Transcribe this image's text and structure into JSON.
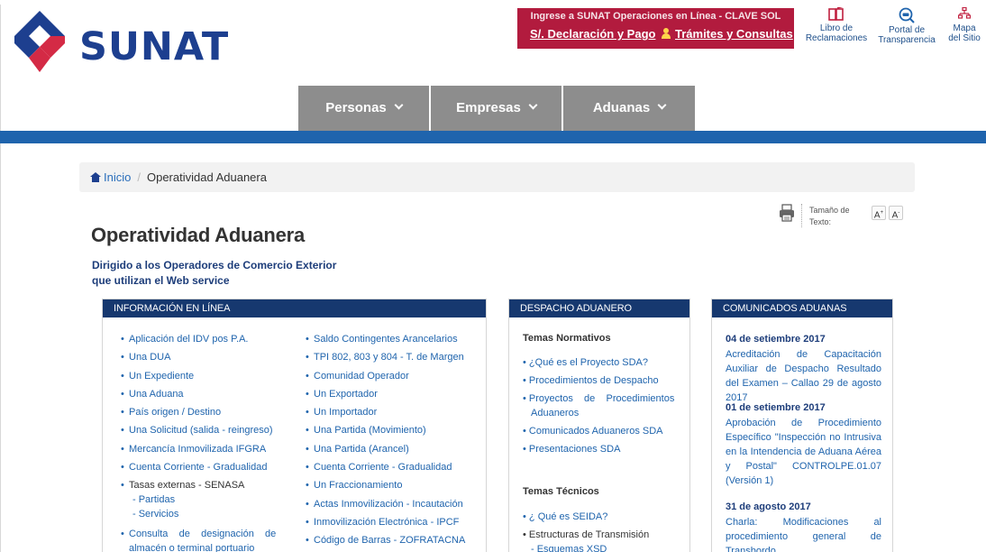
{
  "header": {
    "logo_text": "SUNAT",
    "clave_sol": {
      "title": "Ingrese a SUNAT Operaciones en Línea - CLAVE SOL",
      "link_declaracion": "S/.  Declaración y Pago",
      "link_tramites": "Trámites y Consultas"
    },
    "top_links": [
      {
        "line1": "Libro de",
        "line2": "Reclamaciones",
        "icon": "complaint-book-icon"
      },
      {
        "line1": "Portal de",
        "line2": "Transparencia",
        "icon": "transparency-portal-icon"
      },
      {
        "line1": "Mapa",
        "line2": "del Sitio",
        "icon": "sitemap-icon"
      }
    ],
    "colors": {
      "brand_blue": "#1d3f8f",
      "brand_red": "#d42a45",
      "clave_bg": "#b21b3e",
      "nav_gray": "#8d8d8d",
      "bar_blue": "#1f64ad"
    }
  },
  "nav": {
    "items": [
      "Personas",
      "Empresas",
      "Aduanas"
    ]
  },
  "breadcrumb": {
    "home": "Inicio",
    "current": "Operatividad Aduanera"
  },
  "tools": {
    "text_size_label_1": "Tamaño de",
    "text_size_label_2": "Texto:",
    "increase": "A",
    "decrease": "A",
    "increase_sup": "+",
    "decrease_sup": "-"
  },
  "page": {
    "title": "Operatividad Aduanera",
    "subtitle_line1": "Dirigido a los Operadores de Comercio Exterior",
    "subtitle_line2": "que utilizan el Web service"
  },
  "info_panel": {
    "header": "INFORMACIÓN EN LÍNEA",
    "col1": [
      "Aplicación del IDV pos P.A.",
      "Una DUA",
      "Un Expediente",
      "Una Aduana",
      "País origen / Destino",
      "Una Solicitud (salida - reingreso)",
      "Mercancía Inmovilizada IFGRA",
      "Cuenta Corriente - Gradualidad",
      "Tasas externas - SENASA"
    ],
    "col1_sub": [
      "- Partidas",
      "- Servicios"
    ],
    "col1_last_line1": "Consulta    de    designación    de",
    "col1_last_line2": "almacén o terminal portuario",
    "col2": [
      "Saldo Contingentes Arancelarios",
      "TPI 802, 803 y 804 - T. de Margen",
      "Comunidad Operador",
      "Un Exportador",
      "Un Importador",
      "Una Partida (Movimiento)",
      "Una Partida (Arancel)",
      "Cuenta Corriente - Gradualidad",
      "Un Fraccionamiento",
      "Actas Inmovilización - Incautación",
      "Inmovilización Electrónica - IPCF",
      "Código de Barras - ZOFRATACNA"
    ]
  },
  "despacho_panel": {
    "header": "DESPACHO ADUANERO",
    "normativos_title": "Temas Normativos",
    "normativos": [
      "¿Qué es el Proyecto SDA?",
      "Procedimientos de Despacho",
      "Proyectos    de    Procedimientos",
      "Comunicados Aduaneros SDA",
      "Presentaciones SDA"
    ],
    "normativos_cont": "Aduaneros",
    "tecnicos_title": "Temas Técnicos",
    "tecnicos": [
      "¿ Qué es SEIDA?",
      "Estructuras de Transmisión"
    ],
    "tecnicos_sub": "- Esquemas XSD"
  },
  "comunicados_panel": {
    "header": "COMUNICADOS ADUANAS",
    "items": [
      {
        "date": "04 de setiembre 2017",
        "text": "Acreditación de Capacitación Auxiliar de Despacho Resultado del Examen – Callao 29 de agosto 2017"
      },
      {
        "date": "01 de setiembre 2017",
        "text": "Aprobación de Procedimiento Específico \"Inspección no Intrusiva en la Intendencia de Aduana Aérea y Postal\" CONTROLPE.01.07 (Versión 1)"
      },
      {
        "date": "31 de agosto 2017",
        "text": "Charla: Modificaciones al procedimiento general de Transbordo"
      }
    ]
  }
}
